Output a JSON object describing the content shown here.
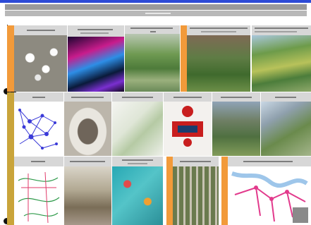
{
  "board": {
    "title": "",
    "subtitle": ""
  },
  "colors": {
    "accent_orange": "#f29a3a",
    "header_gray": "#9a9a9a",
    "rule_blue": "#2d4bd6"
  },
  "rows": [
    {
      "tiles": [
        {
          "name": "tile-white-cluster-model",
          "caption": ""
        },
        {
          "name": "tile-neon-light-show",
          "caption": ""
        },
        {
          "name": "tile-park-aerial",
          "caption": ""
        },
        {
          "name": "tile-green-courtyard",
          "caption": ""
        },
        {
          "name": "tile-highway-greenway",
          "caption": ""
        }
      ]
    },
    {
      "tiles": [
        {
          "name": "tile-network-diagram",
          "caption": ""
        },
        {
          "name": "tile-cube-interior",
          "caption": ""
        },
        {
          "name": "tile-isometric-plan",
          "caption": ""
        },
        {
          "name": "tile-red-structure-drawing",
          "caption": ""
        },
        {
          "name": "tile-landscape-terraces",
          "caption": ""
        },
        {
          "name": "tile-city-aerial",
          "caption": ""
        }
      ]
    },
    {
      "tiles": [
        {
          "name": "tile-site-map",
          "caption": ""
        },
        {
          "name": "tile-street-arcade",
          "caption": ""
        },
        {
          "name": "tile-teal-pool-plan",
          "caption": ""
        },
        {
          "name": "tile-dense-blocks-aerial",
          "caption": ""
        },
        {
          "name": "tile-pink-route-map",
          "caption": ""
        }
      ]
    }
  ]
}
